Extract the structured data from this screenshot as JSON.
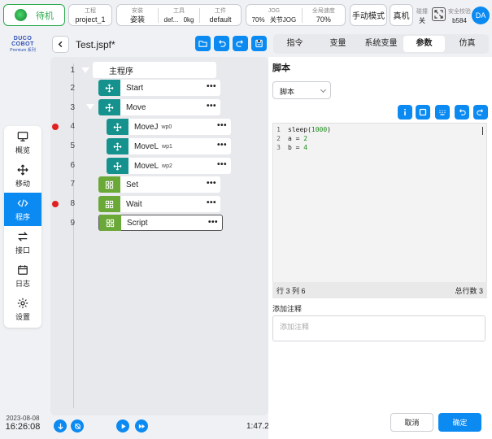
{
  "status": {
    "label": "待机"
  },
  "project": {
    "caption": "工程",
    "value": "project_1"
  },
  "install": {
    "install_caption": "安装",
    "install_value": "姿装",
    "tool_caption": "工具",
    "tool_value": "def...",
    "load_value": "0kg",
    "work_caption": "工件",
    "work_value": "default"
  },
  "jog": {
    "jog_caption": "JOG",
    "jog_value": "70%",
    "joint_value": "关节JOG",
    "speed_caption": "全局速度",
    "speed_value": "70%"
  },
  "mode": {
    "manual_label": "手动模式",
    "real_label": "真机"
  },
  "collision": {
    "caption": "碰撞",
    "value": "关"
  },
  "safety": {
    "caption": "安全校验",
    "value": "b584"
  },
  "user": {
    "avatar": "DA"
  },
  "brand": {
    "name": "DUCO COBOT",
    "sub": "Premium 系列"
  },
  "nav": {
    "items": [
      {
        "label": "概览",
        "icon": "monitor-icon"
      },
      {
        "label": "移动",
        "icon": "move-icon"
      },
      {
        "label": "程序",
        "icon": "code-icon"
      },
      {
        "label": "接口",
        "icon": "swap-icon"
      },
      {
        "label": "日志",
        "icon": "calendar-icon"
      },
      {
        "label": "设置",
        "icon": "gear-icon"
      }
    ]
  },
  "datetime": {
    "date": "2023-08-08",
    "time": "16:26:08"
  },
  "file": {
    "name": "Test.jspf*"
  },
  "program": {
    "line_numbers": [
      "1",
      "2",
      "3",
      "4",
      "5",
      "6",
      "7",
      "8",
      "9"
    ],
    "nodes": [
      {
        "label": "主程序",
        "wp": ""
      },
      {
        "label": "Start",
        "wp": ""
      },
      {
        "label": "Move",
        "wp": ""
      },
      {
        "label": "MoveJ",
        "wp": "wp0"
      },
      {
        "label": "MoveL",
        "wp": "wp1"
      },
      {
        "label": "MoveL",
        "wp": "wp2"
      },
      {
        "label": "Set",
        "wp": ""
      },
      {
        "label": "Wait",
        "wp": ""
      },
      {
        "label": "Script",
        "wp": ""
      }
    ],
    "breakpoint_lines": [
      "4",
      "8"
    ],
    "menu_glyph": "•••",
    "elapsed": "1:47.2"
  },
  "tabs": [
    "指令",
    "变量",
    "系统变量",
    "参数",
    "仿真"
  ],
  "active_tab": "参数",
  "script_panel": {
    "title": "脚本",
    "type_value": "脚本",
    "code": [
      {
        "ln": "1",
        "pre": "sleep(",
        "num": "1000",
        "post": ")"
      },
      {
        "ln": "2",
        "pre": "a = ",
        "num": "2",
        "post": ""
      },
      {
        "ln": "3",
        "pre": "b = ",
        "num": "4",
        "post": ""
      }
    ],
    "cursor_pos": "行 3 列 6",
    "total_lines": "总行数 3",
    "note_label": "添加注释",
    "note_placeholder": "添加注释",
    "cancel_label": "取消",
    "ok_label": "确定"
  },
  "colors": {
    "accent": "#0b8af2",
    "teal": "#15928e",
    "green": "#6aa838",
    "status": "#2aa84a",
    "breakpoint": "#e02020"
  }
}
